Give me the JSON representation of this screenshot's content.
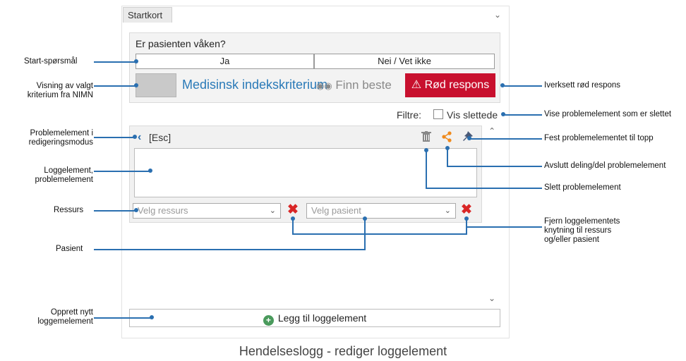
{
  "tab": {
    "label": "Startkort",
    "collapse_icon": "chevron-down-icon"
  },
  "question": {
    "text": "Er pasienten våken?",
    "answers": [
      "Ja",
      "Nei / Vet ikke"
    ]
  },
  "criterion": {
    "link": "Medisinsk indekskriterium",
    "finn_beste": "Finn beste",
    "red_response": "Rød respons"
  },
  "filter": {
    "label": "Filtre:",
    "checkbox_label": "Vis slettede",
    "checked": false
  },
  "problem_element": {
    "back_label": "[Esc]"
  },
  "resource_select": {
    "placeholder": "Velg ressurs"
  },
  "patient_select": {
    "placeholder": "Velg pasient"
  },
  "add_button": {
    "label": "Legg til loggelement"
  },
  "annotations": {
    "start": "Start-spørsmål",
    "visning_1": "Visning av valgt",
    "visning_2": "kriterium fra NIMN",
    "problem_1": "Problemelement i",
    "problem_2": "redigeringsmodus",
    "logg_1": "Loggelement,",
    "logg_2": "problemelement",
    "ressurs": "Ressurs",
    "pasient": "Pasient",
    "opprett_1": "Opprett nytt",
    "opprett_2": "loggemelement",
    "iverksett": "Iverksett rød respons",
    "vise": "Vise problemelement som er slettet",
    "fest": "Fest problemelementet til topp",
    "avslutt": "Avslutt deling/del problemelement",
    "slett": "Slett problemelement",
    "fjern_1": "Fjern loggelementets",
    "fjern_2": "knytning til ressurs",
    "fjern_3": "og/eller pasient"
  },
  "caption": "Hendelseslogg - rediger loggelement",
  "colors": {
    "accent": "#2a6fb0",
    "red_response": "#c8102e",
    "link": "#2a7ab8",
    "share": "#f08a1c",
    "delete_x": "#d92626"
  }
}
